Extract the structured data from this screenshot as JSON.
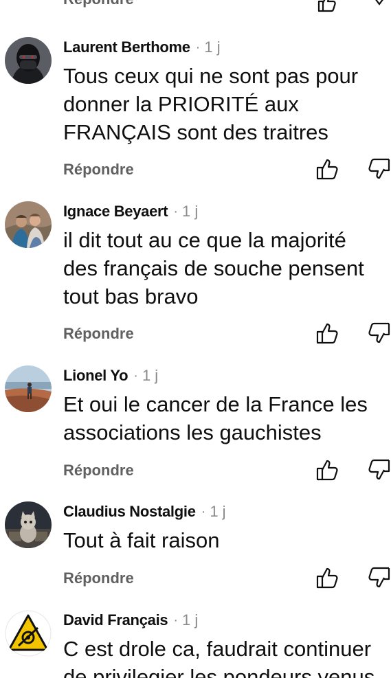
{
  "reply_label": "Répondre",
  "comments": [
    {
      "author": "Laurent Berthome",
      "separator": "·",
      "time": "1 j",
      "text": "Tous ceux qui ne sont pas pour donner la PRIORITÉ aux FRANÇAIS sont des traitres"
    },
    {
      "author": "Ignace Beyaert",
      "separator": "·",
      "time": "1 j",
      "text": "il dit tout au ce que la majorité des français de souche pensent tout bas bravo"
    },
    {
      "author": "Lionel Yo",
      "separator": "·",
      "time": "1 j",
      "text": "Et oui le cancer de la France les associations les gauchistes"
    },
    {
      "author": "Claudius Nostalgie",
      "separator": "·",
      "time": "1 j",
      "text": "Tout à fait raison"
    },
    {
      "author": "David Français",
      "separator": "·",
      "time": "1 j",
      "text": "C est drole ca, faudrait continuer de privilegier les pondeurs venus"
    }
  ],
  "colors": {
    "text": "#0f0f0f",
    "secondary": "#606060",
    "timestamp": "#8a8a8a",
    "background": "#ffffff"
  },
  "icons": {
    "like": "thumb-up-icon",
    "dislike": "thumb-down-icon"
  }
}
